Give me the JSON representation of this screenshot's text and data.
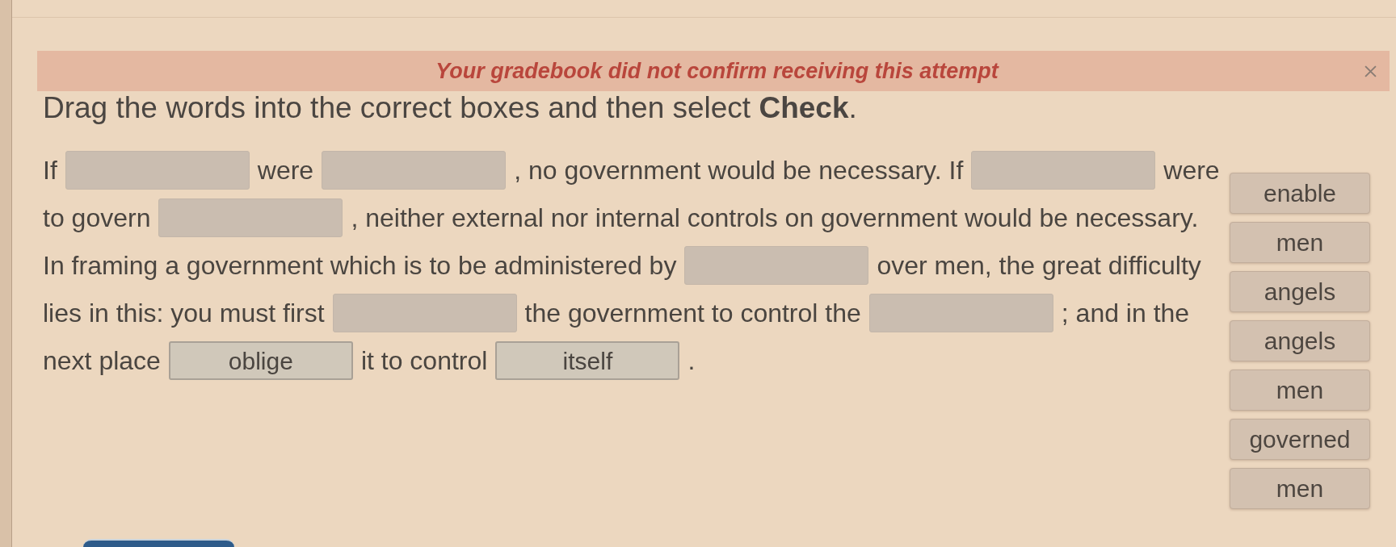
{
  "alert": {
    "message": "Your gradebook did not confirm receiving this attempt"
  },
  "instructions": "Drag the words into the correct boxes and then select **Check**.",
  "passage": {
    "lines": [
      [
        {
          "kind": "text",
          "text": "If"
        },
        {
          "kind": "blank"
        },
        {
          "kind": "text",
          "text": "were"
        },
        {
          "kind": "blank"
        },
        {
          "kind": "text",
          "text": ", no government would be necessary. If"
        },
        {
          "kind": "blank"
        },
        {
          "kind": "text",
          "text": "were"
        }
      ],
      [
        {
          "kind": "text",
          "text": "to govern"
        },
        {
          "kind": "blank"
        },
        {
          "kind": "text",
          "text": ", neither external nor internal controls on government would be necessary."
        }
      ],
      [
        {
          "kind": "text",
          "text": "In framing a government which is to be administered by"
        },
        {
          "kind": "blank"
        },
        {
          "kind": "text",
          "text": "over men, the great difficulty"
        }
      ],
      [
        {
          "kind": "text",
          "text": "lies in this: you must first"
        },
        {
          "kind": "blank"
        },
        {
          "kind": "text",
          "text": "the government to control the"
        },
        {
          "kind": "blank"
        },
        {
          "kind": "text",
          "text": "; and in the"
        }
      ],
      [
        {
          "kind": "text",
          "text": "next place"
        },
        {
          "kind": "blank",
          "word": "oblige"
        },
        {
          "kind": "text",
          "text": "it to control"
        },
        {
          "kind": "blank",
          "word": "itself"
        },
        {
          "kind": "text",
          "text": "."
        }
      ]
    ]
  },
  "word_bank": [
    {
      "word": "enable"
    },
    {
      "word": "men"
    },
    {
      "word": "angels"
    },
    {
      "word": "angels"
    },
    {
      "word": "men"
    },
    {
      "word": "governed"
    },
    {
      "word": "men"
    }
  ]
}
